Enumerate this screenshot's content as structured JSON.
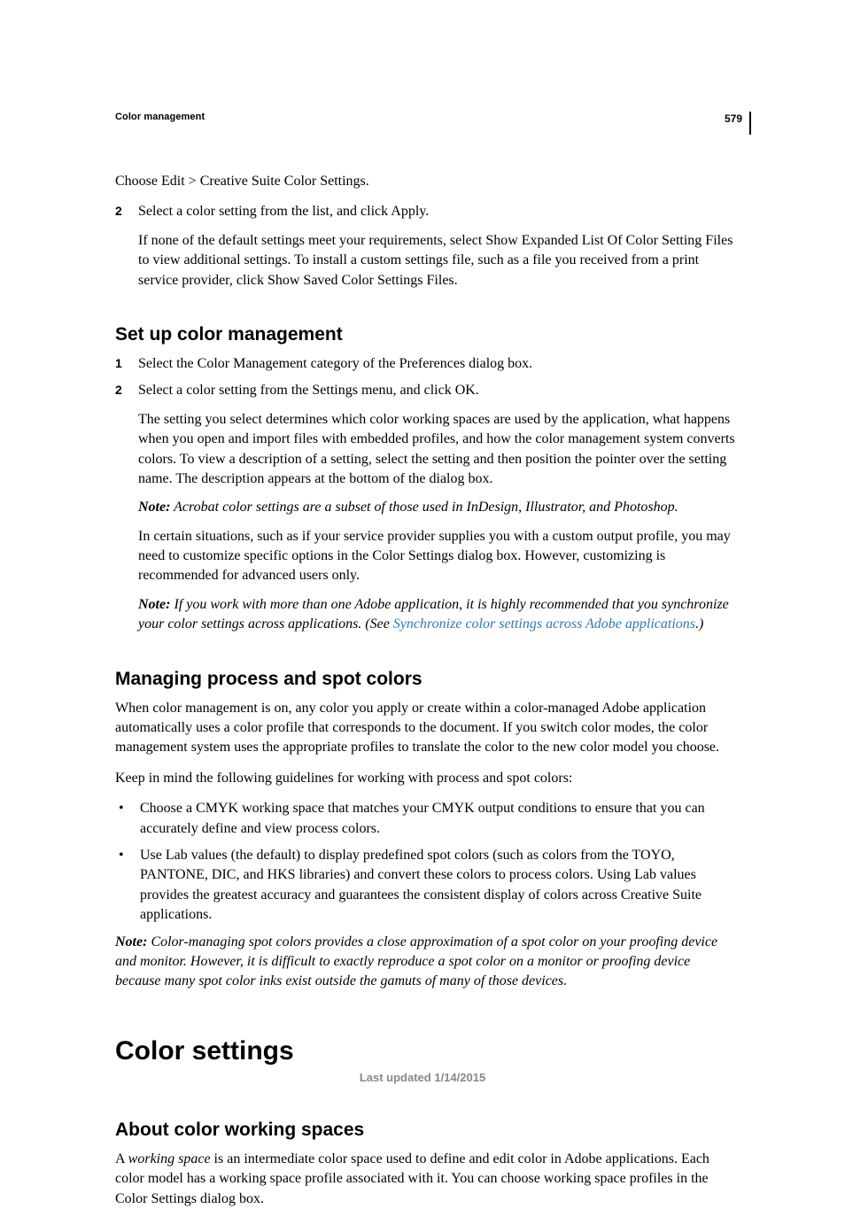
{
  "page_number": "579",
  "running_header": "Color management",
  "intro_line": "Choose Edit > Creative Suite Color Settings.",
  "step2": {
    "num": "2",
    "main": "Select a color setting from the list, and click Apply.",
    "sub": "If none of the default settings meet your requirements, select Show Expanded List Of Color Setting Files to view additional settings. To install a custom settings file, such as a file you received from a print service provider, click Show Saved Color Settings Files."
  },
  "section_setup": {
    "title": "Set up color management",
    "step1": {
      "num": "1",
      "main": "Select the Color Management category of the Preferences dialog box."
    },
    "step2": {
      "num": "2",
      "main": "Select a color setting from the Settings menu, and click OK.",
      "sub1": "The setting you select determines which color working spaces are used by the application, what happens when you open and import files with embedded profiles, and how the color management system converts colors. To view a description of a setting, select the setting and then position the pointer over the setting name. The description appears at the bottom of the dialog box.",
      "note1_label": "Note:",
      "note1_body": " Acrobat color settings are a subset of those used in InDesign, Illustrator, and Photoshop.",
      "sub2": "In certain situations, such as if your service provider supplies you with a custom output profile, you may need to customize specific options in the Color Settings dialog box. However, customizing is recommended for advanced users only.",
      "note2_label": "Note:",
      "note2_before": " If you work with more than one Adobe application, it is highly recommended that you synchronize your color settings across applications. (See ",
      "note2_link": "Synchronize color settings across Adobe applications",
      "note2_after": ".)"
    }
  },
  "section_process": {
    "title": "Managing process and spot colors",
    "p1": "When color management is on, any color you apply or create within a color-managed Adobe application automatically uses a color profile that corresponds to the document. If you switch color modes, the color management system uses the appropriate profiles to translate the color to the new color model you choose.",
    "p2": "Keep in mind the following guidelines for working with process and spot colors:",
    "b1": "Choose a CMYK working space that matches your CMYK output conditions to ensure that you can accurately define and view process colors.",
    "b2": "Use Lab values (the default) to display predefined spot colors (such as colors from the TOYO, PANTONE, DIC, and HKS libraries) and convert these colors to process colors. Using Lab values provides the greatest accuracy and guarantees the consistent display of colors across Creative Suite applications.",
    "note_label": "Note:",
    "note_body": " Color-managing spot colors provides a close approximation of a spot color on your proofing device and monitor. However, it is difficult to exactly reproduce a spot color on a monitor or proofing device because many spot color inks exist outside the gamuts of many of those devices."
  },
  "h1_color_settings": "Color settings",
  "section_about": {
    "title": "About color working spaces",
    "p_before": "A ",
    "p_term": "working space",
    "p_after": " is an intermediate color space used to define and edit color in Adobe applications. Each color model has a working space profile associated with it. You can choose working space profiles in the Color Settings dialog box."
  },
  "footer": "Last updated 1/14/2015"
}
